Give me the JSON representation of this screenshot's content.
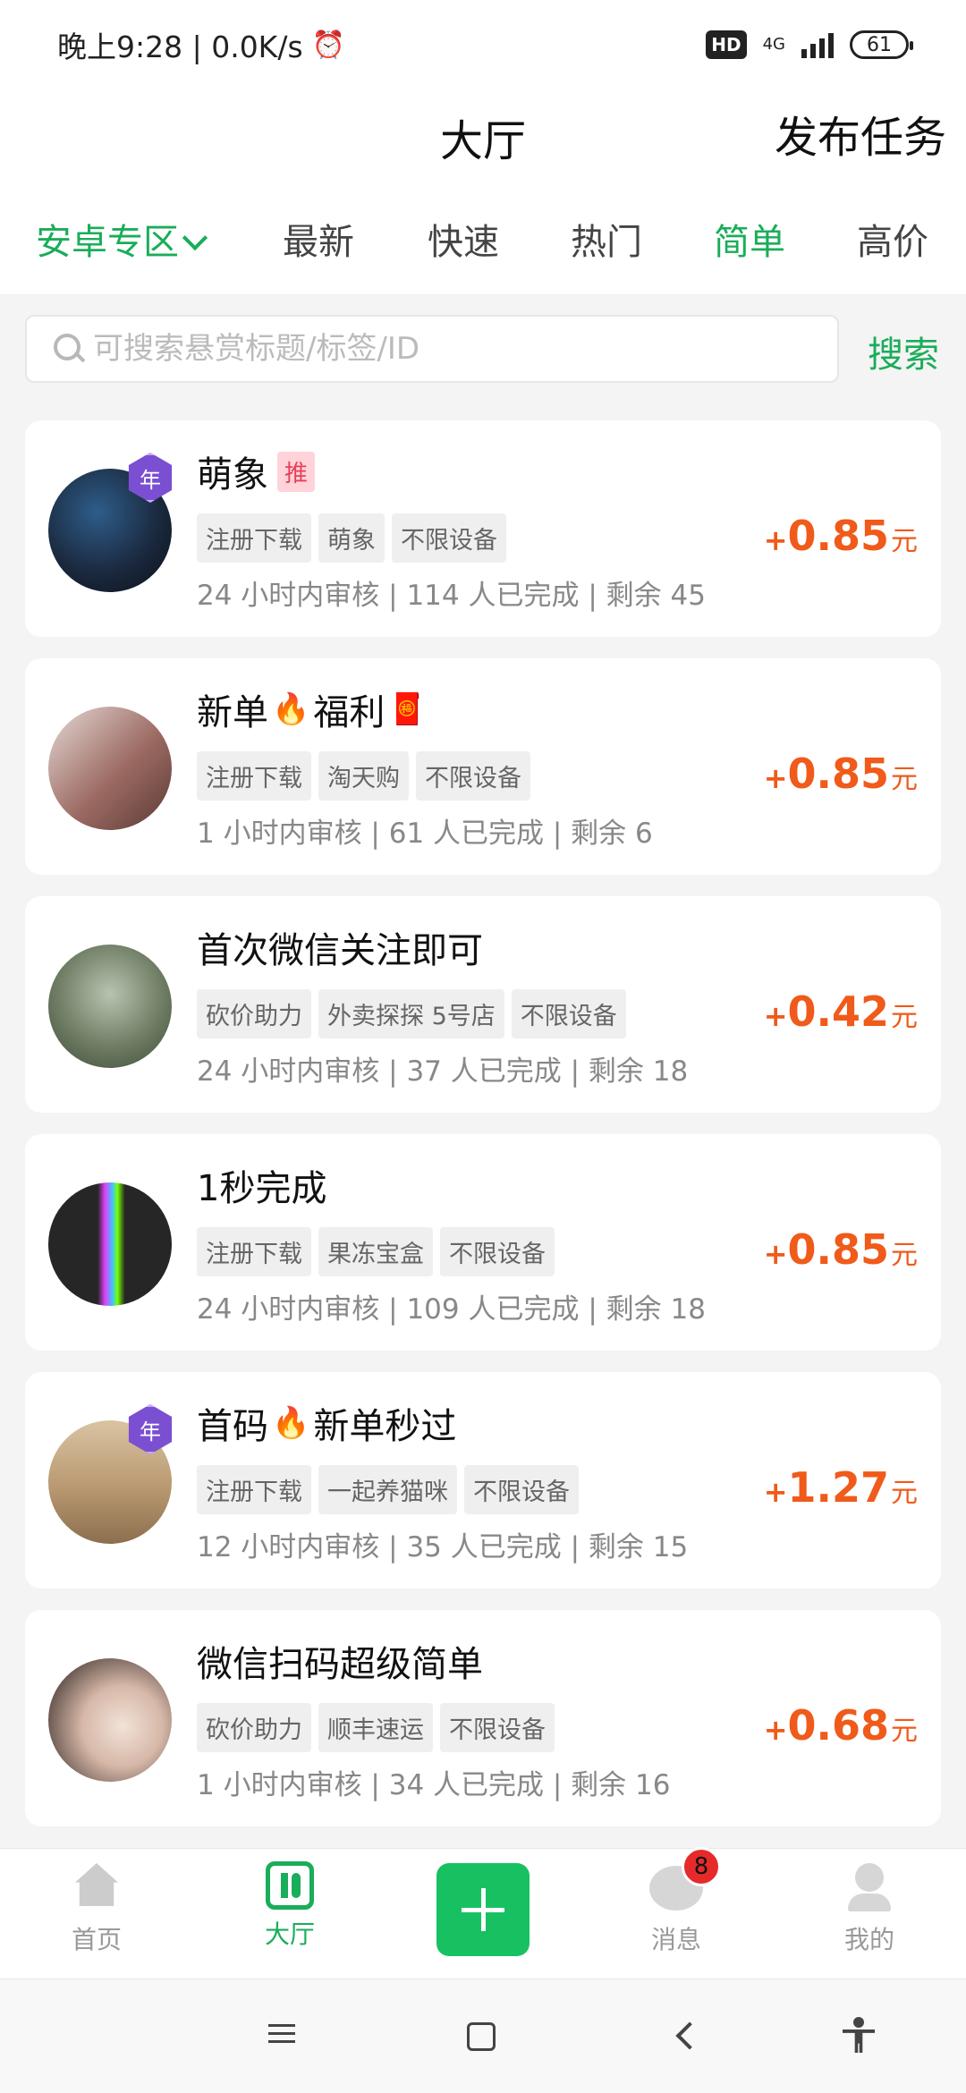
{
  "status_bar": {
    "time": "晚上9:28 | 0.0K/s",
    "hd": "HD",
    "network": "4G",
    "battery": "61"
  },
  "header": {
    "title": "大厅",
    "publish_label": "发布任务"
  },
  "tabs": [
    {
      "label": "安卓专区",
      "active": true
    },
    {
      "label": "最新"
    },
    {
      "label": "快速"
    },
    {
      "label": "热门"
    },
    {
      "label": "简单",
      "active": true
    },
    {
      "label": "高价"
    }
  ],
  "search": {
    "placeholder": "可搜索悬赏标题/标签/ID",
    "button_label": "搜索"
  },
  "tasks": [
    {
      "title": "萌象",
      "badge": "推",
      "year_badge": "年",
      "tags": [
        "注册下载",
        "萌象",
        "不限设备"
      ],
      "meta": "24 小时内审核 | 114 人已完成 | 剩余 45",
      "plus": "+",
      "amount": "0.85",
      "unit": "元",
      "avatar_colors": [
        "#1b2a40",
        "#2e5d8a"
      ]
    },
    {
      "title": "新单",
      "title_suffix": "福利",
      "tags": [
        "注册下载",
        "淘天购",
        "不限设备"
      ],
      "meta": "1 小时内审核 | 61 人已完成 | 剩余 6",
      "plus": "+",
      "amount": "0.85",
      "unit": "元",
      "avatar_colors": [
        "#9c6b63",
        "#d7c7c4"
      ]
    },
    {
      "title": "首次微信关注即可",
      "tags": [
        "砍价助力",
        "外卖探探 5号店",
        "不限设备"
      ],
      "meta": "24 小时内审核 | 37 人已完成 | 剩余 18",
      "plus": "+",
      "amount": "0.42",
      "unit": "元",
      "avatar_colors": [
        "#5c6b52",
        "#b8c3b0"
      ]
    },
    {
      "title": "1秒完成",
      "tags": [
        "注册下载",
        "果冻宝盒",
        "不限设备"
      ],
      "meta": "24 小时内审核 | 109 人已完成 | 剩余 18",
      "plus": "+",
      "amount": "0.85",
      "unit": "元",
      "avatar_colors": [
        "#262626",
        "#4a4a4a"
      ]
    },
    {
      "title": "首码",
      "title_suffix": "新单秒过",
      "year_badge": "年",
      "tags": [
        "注册下载",
        "一起养猫咪",
        "不限设备"
      ],
      "meta": "12 小时内审核 | 35 人已完成 | 剩余 15",
      "plus": "+",
      "amount": "1.27",
      "unit": "元",
      "avatar_colors": [
        "#b89870",
        "#d9c4a3"
      ]
    },
    {
      "title": "微信扫码超级简单",
      "tags": [
        "砍价助力",
        "顺丰速运",
        "不限设备"
      ],
      "meta": "1 小时内审核 | 34 人已完成 | 剩余 16",
      "plus": "+",
      "amount": "0.68",
      "unit": "元",
      "avatar_colors": [
        "#5a4a44",
        "#e6d4cc"
      ]
    }
  ],
  "bottom_nav": {
    "home": "首页",
    "hall": "大厅",
    "messages": "消息",
    "messages_badge": "8",
    "mine": "我的"
  },
  "colors": {
    "accent": "#1aad5a",
    "reward": "#f05a1a",
    "badge_red": "#e62a2a"
  }
}
